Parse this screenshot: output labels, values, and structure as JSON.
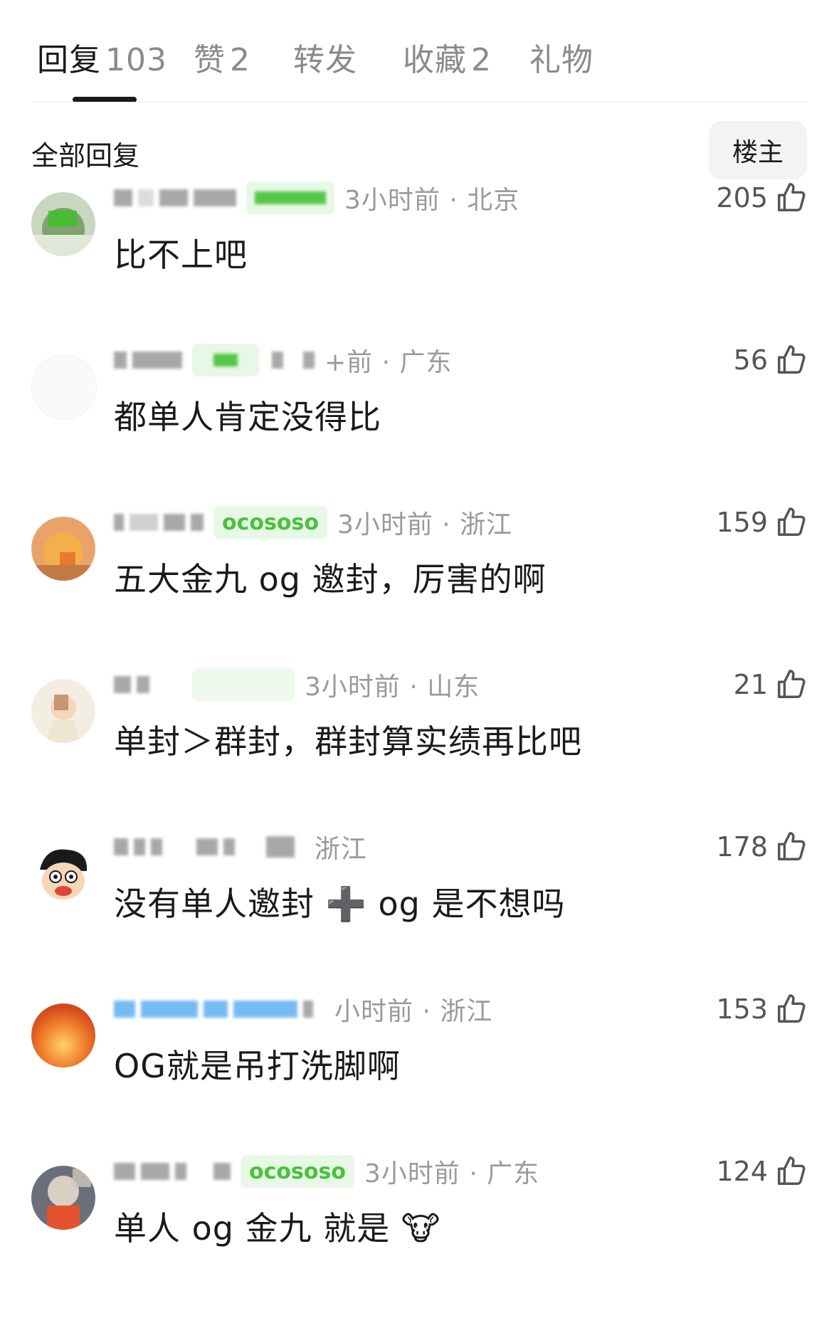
{
  "tabs": [
    {
      "label": "回复",
      "count": "103"
    },
    {
      "label": "赞",
      "count": "2"
    },
    {
      "label": "转发",
      "count": ""
    },
    {
      "label": "收藏",
      "count": "2"
    },
    {
      "label": "礼物",
      "count": ""
    }
  ],
  "filter": {
    "all_replies": "全部回复",
    "op_only": "楼主"
  },
  "comments": [
    {
      "meta": "3小时前 · 北京",
      "likes": "205",
      "text": "比不上吧",
      "badge": ""
    },
    {
      "meta": "+前 · 广东",
      "likes": "56",
      "text": "都单人肯定没得比",
      "badge": ""
    },
    {
      "meta": "3小时前 · 浙江",
      "likes": "159",
      "text": "五大金九 og 邀封，厉害的啊",
      "badge": "ocososo"
    },
    {
      "meta": "3小时前 · 山东",
      "likes": "21",
      "text": "单封＞群封，群封算实绩再比吧",
      "badge": ""
    },
    {
      "meta": "浙江",
      "likes": "178",
      "text": "没有单人邀封 ➕ og 是不想吗",
      "badge": ""
    },
    {
      "meta": "小时前 · 浙江",
      "likes": "153",
      "text": "OG就是吊打洗脚啊",
      "badge": ""
    },
    {
      "meta": "3小时前 · 广东",
      "likes": "124",
      "text": "单人 og 金九 就是 🐮",
      "badge": "ocososo"
    }
  ],
  "colors": {
    "accent_green": "#49c23b",
    "muted_text": "#9a9a9a",
    "text": "#1a1a1a"
  },
  "icons": {
    "like": "thumbs-up-outline-icon"
  }
}
